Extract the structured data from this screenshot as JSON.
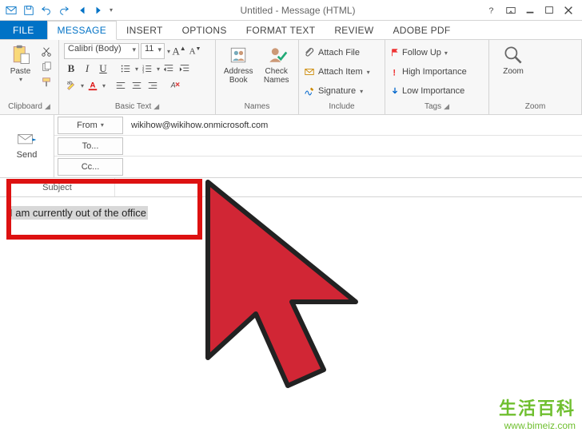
{
  "title": "Untitled - Message (HTML)",
  "tabs": {
    "file": "FILE",
    "message": "MESSAGE",
    "insert": "INSERT",
    "options": "OPTIONS",
    "format": "FORMAT TEXT",
    "review": "REVIEW",
    "adobe": "ADOBE PDF"
  },
  "ribbon": {
    "clipboard": {
      "label": "Clipboard",
      "paste": "Paste"
    },
    "basictext": {
      "label": "Basic Text",
      "font": "Calibri (Body)",
      "size": "11",
      "b": "B",
      "i": "I",
      "u": "U"
    },
    "names": {
      "label": "Names",
      "address": "Address Book",
      "check": "Check Names"
    },
    "include": {
      "label": "Include",
      "attachfile": "Attach File",
      "attachitem": "Attach Item",
      "signature": "Signature"
    },
    "tags": {
      "label": "Tags",
      "followup": "Follow Up",
      "high": "High Importance",
      "low": "Low Importance"
    },
    "zoom": {
      "label": "Zoom",
      "zoom": "Zoom"
    }
  },
  "compose": {
    "send": "Send",
    "from_label": "From",
    "from_value": "wikihow@wikihow.onmicrosoft.com",
    "to_label": "To...",
    "cc_label": "Cc...",
    "subject_label": "Subject"
  },
  "body_text": "I am currently out of the office",
  "watermark": {
    "cn": "生活百科",
    "url": "www.bimeiz.com"
  }
}
